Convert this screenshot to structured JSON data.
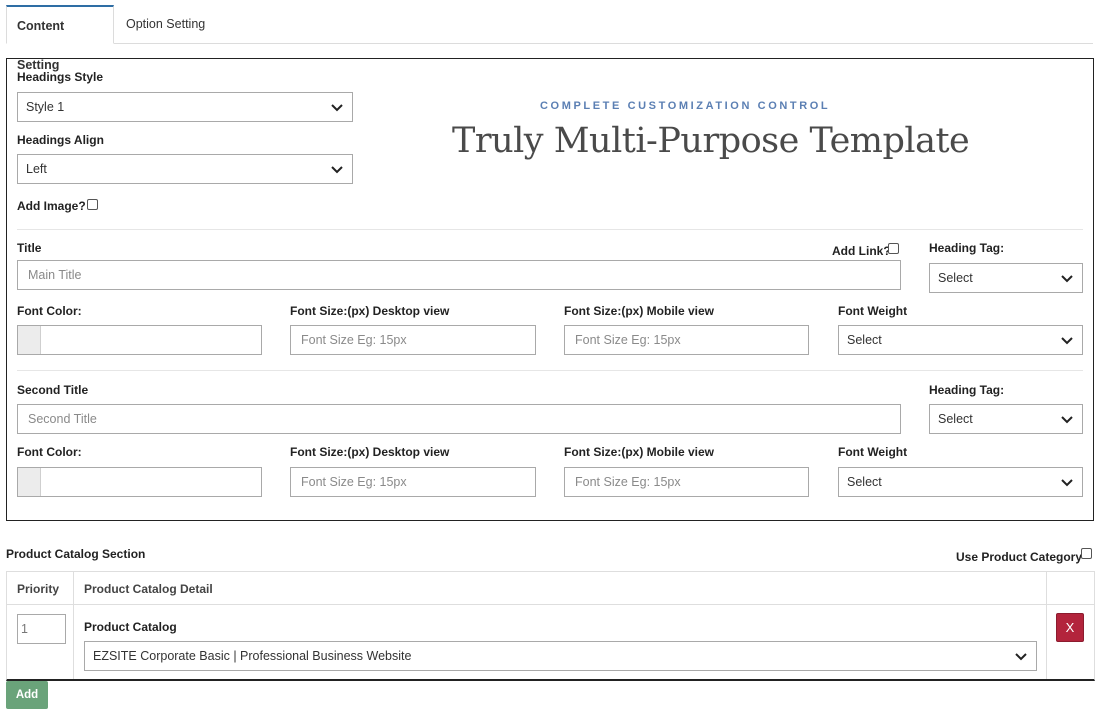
{
  "tabs": [
    {
      "label": "Content Setting",
      "active": true
    },
    {
      "label": "Option Setting",
      "active": false
    }
  ],
  "headings": {
    "style_label": "Headings Style",
    "style_value": "Style 1",
    "align_label": "Headings Align",
    "align_value": "Left",
    "add_image_label": "Add Image?"
  },
  "preview": {
    "tagline": "COMPLETE CUSTOMIZATION CONTROL",
    "headline": "Truly Multi-Purpose Template"
  },
  "title_section": {
    "title_label": "Title",
    "title_placeholder": "Main Title",
    "add_link_label": "Add Link?",
    "heading_tag_label": "Heading Tag:",
    "heading_tag_value": "Select",
    "font_color_label": "Font Color:",
    "font_size_desktop_label": "Font Size:(px) Desktop view",
    "font_size_desktop_placeholder": "Font Size Eg: 15px",
    "font_size_mobile_label": "Font Size:(px) Mobile view",
    "font_size_mobile_placeholder": "Font Size Eg: 15px",
    "font_weight_label": "Font Weight",
    "font_weight_value": "Select"
  },
  "second_title_section": {
    "title_label": "Second Title",
    "title_placeholder": "Second Title",
    "heading_tag_label": "Heading Tag:",
    "heading_tag_value": "Select",
    "font_color_label": "Font Color:",
    "font_size_desktop_label": "Font Size:(px) Desktop view",
    "font_size_desktop_placeholder": "Font Size Eg: 15px",
    "font_size_mobile_label": "Font Size:(px) Mobile view",
    "font_size_mobile_placeholder": "Font Size Eg: 15px",
    "font_weight_label": "Font Weight",
    "font_weight_value": "Select"
  },
  "catalog": {
    "section_label": "Product Catalog Section",
    "use_category_label": "Use Product Category",
    "columns": [
      "Priority",
      "Product Catalog Detail"
    ],
    "rows": [
      {
        "priority": "1",
        "detail_label": "Product Catalog",
        "detail_value": "EZSITE Corporate Basic | Professional Business Website",
        "remove_label": "X"
      }
    ],
    "add_label": "Add"
  },
  "colors": {
    "accent_blue": "#2e6da4",
    "tagline_blue": "#5b7fb3",
    "remove_red": "#b3243c",
    "add_green": "#6aa37a"
  }
}
